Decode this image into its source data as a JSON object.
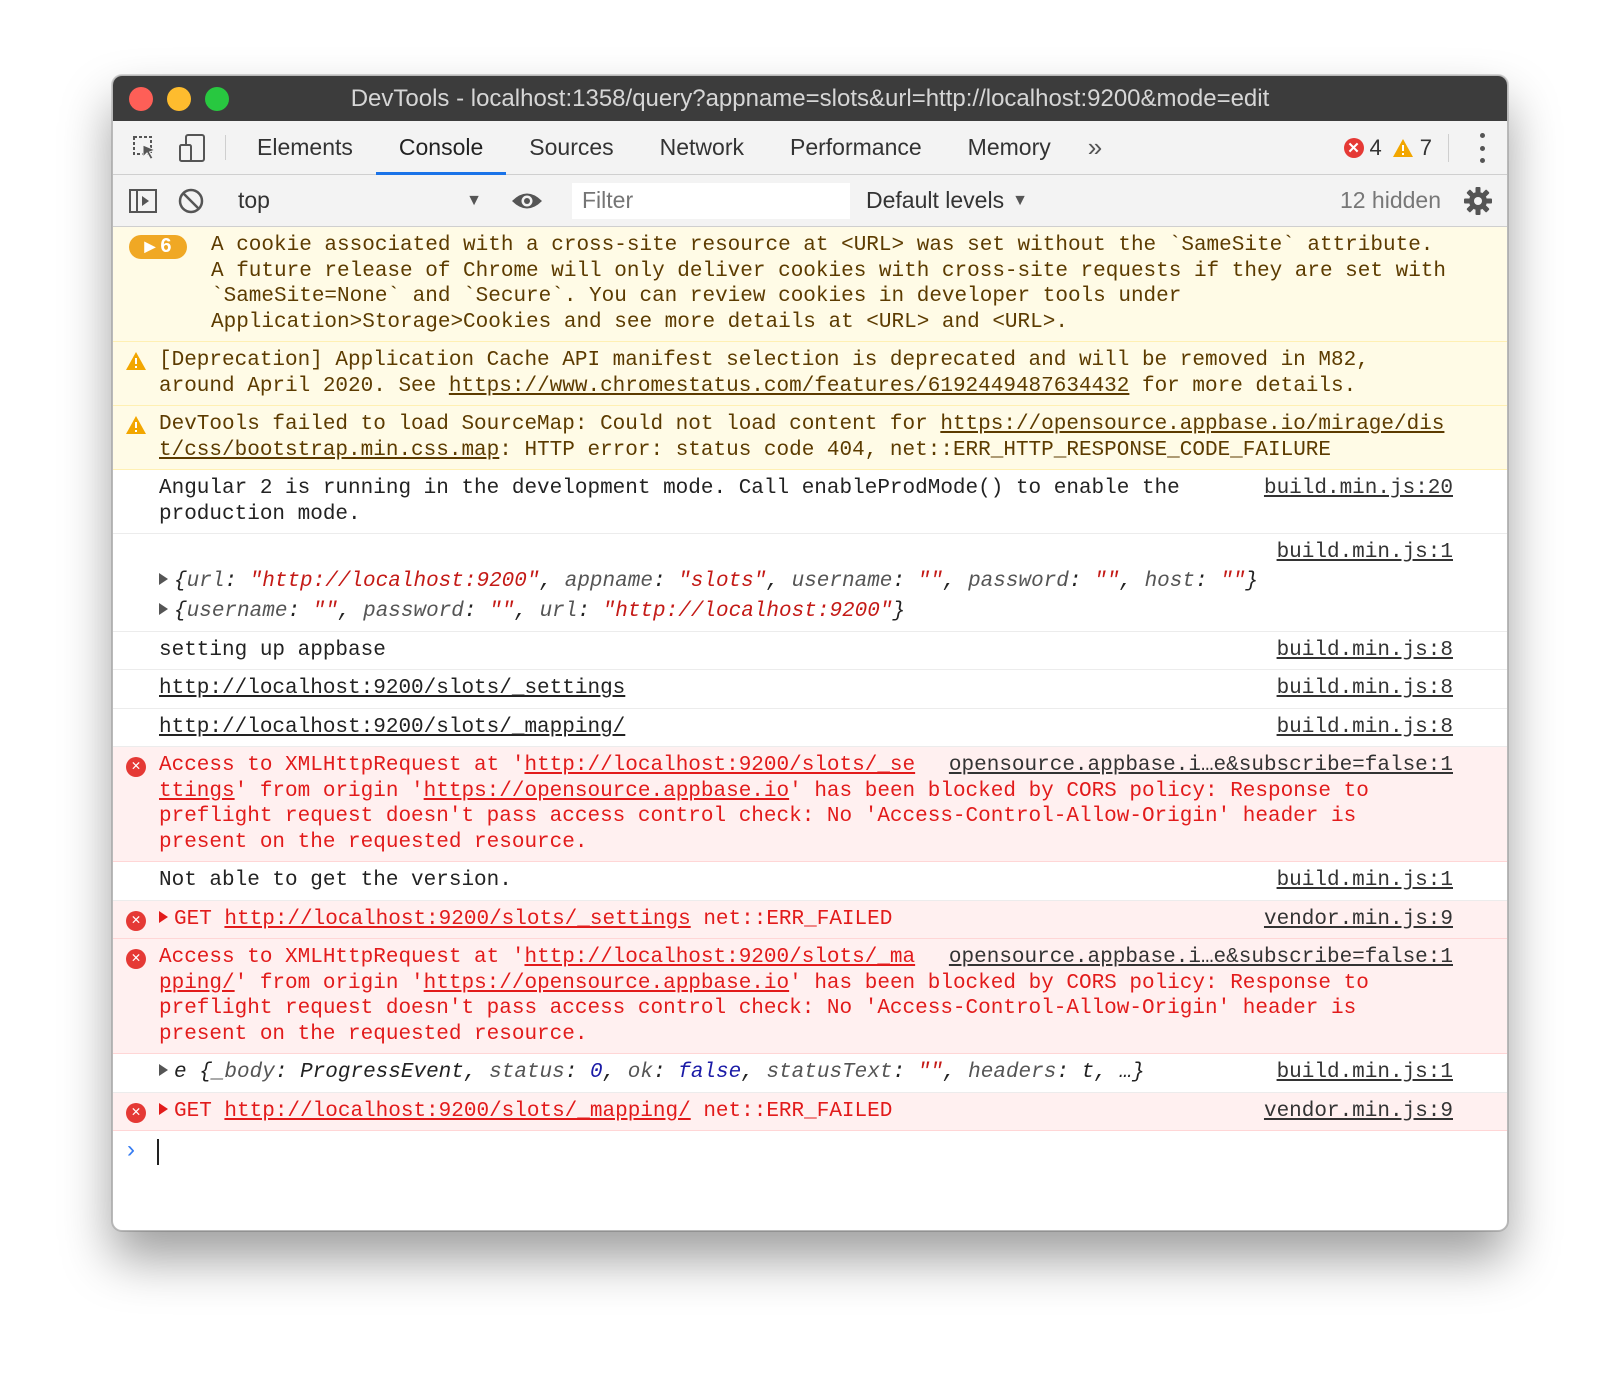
{
  "window": {
    "title": "DevTools - localhost:1358/query?appname=slots&url=http://localhost:9200&mode=edit"
  },
  "tabs": [
    {
      "label": "Elements"
    },
    {
      "label": "Console",
      "active": true
    },
    {
      "label": "Sources"
    },
    {
      "label": "Network"
    },
    {
      "label": "Performance"
    },
    {
      "label": "Memory"
    }
  ],
  "tabs_more_label": "»",
  "counts": {
    "errors": "4",
    "warnings": "7"
  },
  "toolbar": {
    "context": "top",
    "filter_placeholder": "Filter",
    "levels": "Default levels",
    "hidden": "12 hidden"
  },
  "messages": {
    "m1": {
      "count": "6",
      "text": "A cookie associated with a cross-site resource at <URL> was set without the `SameSite` attribute. A future release of Chrome will only deliver cookies with cross-site requests if they are set with `SameSite=None` and `Secure`. You can review cookies in developer tools under Application>Storage>Cookies and see more details at <URL> and <URL>."
    },
    "m2": {
      "pre": "[Deprecation] Application Cache API manifest selection is deprecated and will be removed in M82, around April 2020. See ",
      "link": "https://www.chromestatus.com/features/6192449487634432",
      "post": " for more details."
    },
    "m3": {
      "pre": "DevTools failed to load SourceMap: Could not load content for ",
      "link": "https://opensource.appbase.io/mirage/dist/css/bootstrap.min.css.map",
      "post": ": HTTP error: status code 404, net::ERR_HTTP_RESPONSE_CODE_FAILURE"
    },
    "m4": {
      "text": "Angular 2 is running in the development mode. Call enableProdMode() to enable the production mode.",
      "source": "build.min.js:20"
    },
    "m5": {
      "source": "build.min.js:1",
      "obj1": {
        "k1": "url",
        "v1": "\"http://localhost:9200\"",
        "k2": "appname",
        "v2": "\"slots\"",
        "k3": "username",
        "v3": "\"\"",
        "k4": "password",
        "v4": "\"\"",
        "k5": "host",
        "v5": "\"\""
      },
      "obj2": {
        "k1": "username",
        "v1": "\"\"",
        "k2": "password",
        "v2": "\"\"",
        "k3": "url",
        "v3": "\"http://localhost:9200\""
      }
    },
    "m6": {
      "text": "setting up appbase",
      "source": "build.min.js:8"
    },
    "m7": {
      "link": "http://localhost:9200/slots/_settings",
      "source": "build.min.js:8"
    },
    "m8": {
      "link": "http://localhost:9200/slots/_mapping/",
      "source": "build.min.js:8"
    },
    "m9": {
      "pre": "Access to XMLHttpRequest at '",
      "link1": "http://localhost:9200/slots/_settings",
      "mid": "' from origin '",
      "link2": "https://opensource.appbase.io",
      "post": "' has been blocked by CORS policy: Response to preflight request doesn't pass access control check: No 'Access-Control-Allow-Origin' header is present on the requested resource.",
      "source": "opensource.appbase.i…e&subscribe=false:1"
    },
    "m10": {
      "text": "Not able to get the version.",
      "source": "build.min.js:1"
    },
    "m11": {
      "method": "GET",
      "link": "http://localhost:9200/slots/_settings",
      "status": "net::ERR_FAILED",
      "source": "vendor.min.js:9"
    },
    "m12": {
      "pre": "Access to XMLHttpRequest at '",
      "link1": "http://localhost:9200/slots/_mapping/",
      "mid": "' from origin '",
      "link2": "https://opensource.appbase.io",
      "post": "' has been blocked by CORS policy: Response to preflight request doesn't pass access control check: No 'Access-Control-Allow-Origin' header is present on the requested resource.",
      "source": "opensource.appbase.i…e&subscribe=false:1"
    },
    "m13": {
      "name": "e",
      "k1": "_body",
      "v1": "ProgressEvent",
      "k2": "status",
      "v2": "0",
      "k3": "ok",
      "v3": "false",
      "k4": "statusText",
      "v4": "\"\"",
      "k5": "headers",
      "v5": "t",
      "ellipsis": "…",
      "source": "build.min.js:1"
    },
    "m14": {
      "method": "GET",
      "link": "http://localhost:9200/slots/_mapping/",
      "status": "net::ERR_FAILED",
      "source": "vendor.min.js:9"
    }
  },
  "prompt": {
    "symbol": "›"
  },
  "colors": {
    "accent": "#1a73e8",
    "error": "#e21b1b",
    "warning_bg": "#fffbe6",
    "error_bg": "#fff0f0"
  }
}
